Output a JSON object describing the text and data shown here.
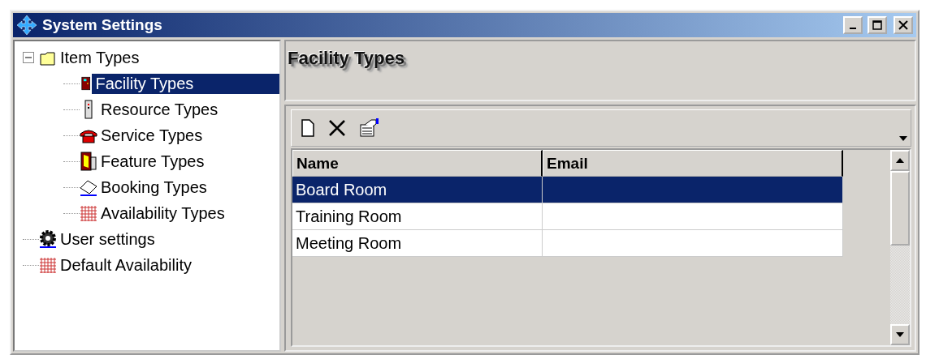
{
  "window": {
    "title": "System Settings"
  },
  "tree": [
    {
      "label": "Item Types",
      "kind": "folder",
      "selected": false,
      "expanded": true,
      "children": [
        {
          "label": "Facility Types",
          "kind": "door",
          "selected": true
        },
        {
          "label": "Resource Types",
          "kind": "remote",
          "selected": false
        },
        {
          "label": "Service Types",
          "kind": "phone",
          "selected": false
        },
        {
          "label": "Feature Types",
          "kind": "door-remote",
          "selected": false
        },
        {
          "label": "Booking Types",
          "kind": "book",
          "selected": false
        },
        {
          "label": "Availability Types",
          "kind": "grid",
          "selected": false
        }
      ]
    },
    {
      "label": "User settings",
      "kind": "gear",
      "selected": false
    },
    {
      "label": "Default Availability",
      "kind": "grid",
      "selected": false
    }
  ],
  "panel": {
    "title": "Facility Types"
  },
  "table": {
    "columns": [
      "Name",
      "Email"
    ],
    "rows": [
      {
        "name": "Board Room",
        "selected": true
      },
      {
        "name": "Training Room",
        "selected": false
      },
      {
        "name": "Meeting Room",
        "selected": false
      }
    ]
  }
}
